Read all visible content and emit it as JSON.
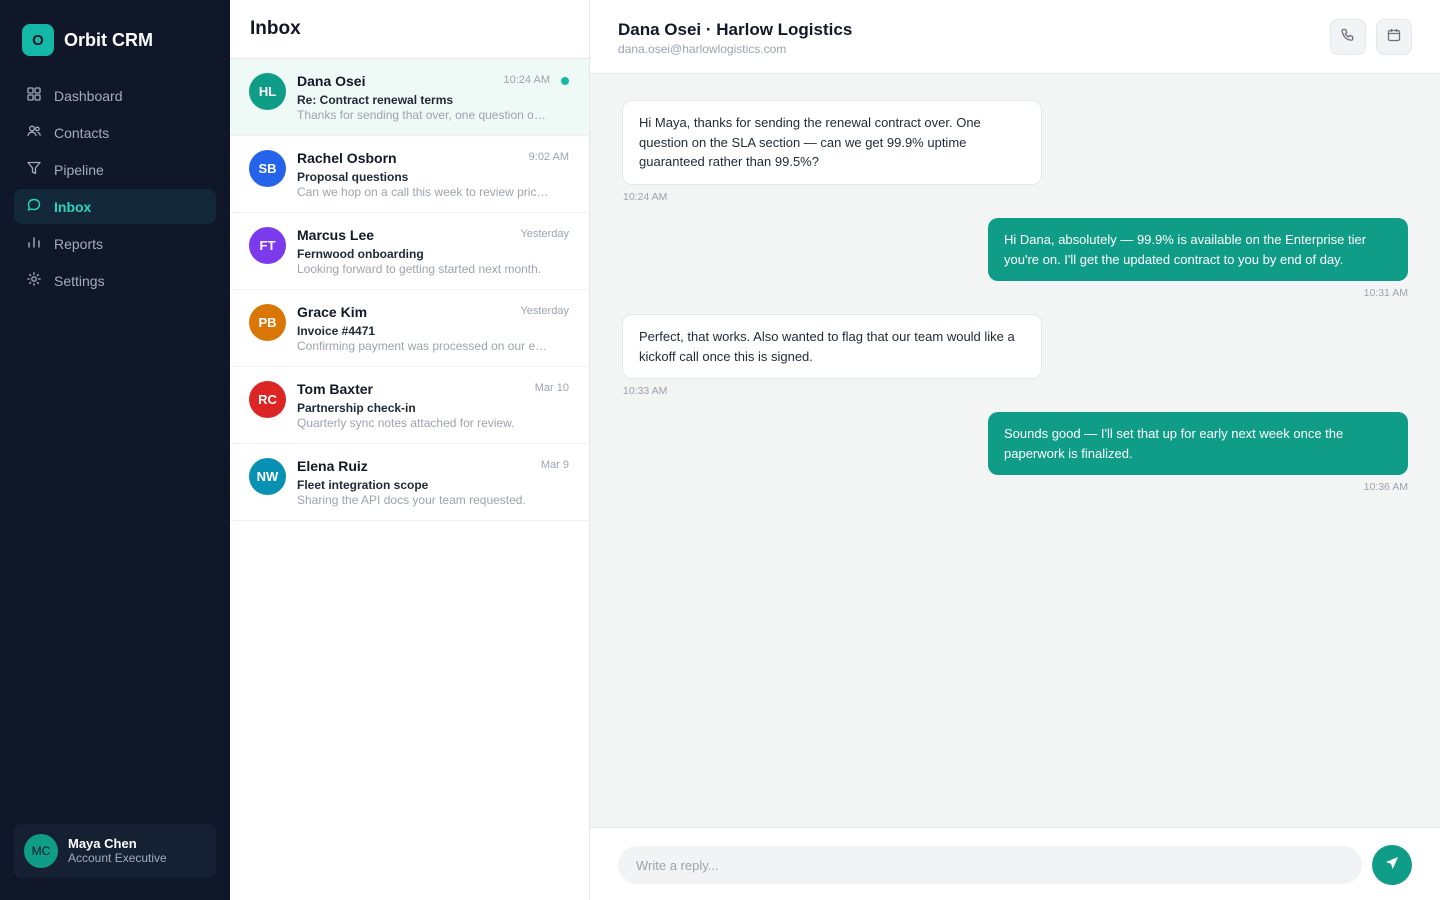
{
  "app": {
    "logo_letter": "O",
    "name": "Orbit CRM"
  },
  "nav": {
    "items": [
      {
        "label": "Dashboard",
        "icon": "grid-icon",
        "active": false
      },
      {
        "label": "Contacts",
        "icon": "users-icon",
        "active": false
      },
      {
        "label": "Pipeline",
        "icon": "funnel-icon",
        "active": false
      },
      {
        "label": "Inbox",
        "icon": "chat-bubble-icon",
        "active": true
      },
      {
        "label": "Reports",
        "icon": "bar-chart-icon",
        "active": false
      },
      {
        "label": "Settings",
        "icon": "gear-icon",
        "active": false
      }
    ]
  },
  "user": {
    "initials": "MC",
    "name": "Maya Chen",
    "role": "Account Executive"
  },
  "inbox": {
    "title": "Inbox",
    "conversations": [
      {
        "initials": "HL",
        "name": "Dana Osei",
        "subject": "Re: Contract renewal terms",
        "preview": "Thanks for sending that over, one question on the SLA section",
        "time": "10:24 AM",
        "color": "#0f9d88",
        "unread": true,
        "active": true
      },
      {
        "initials": "SB",
        "name": "Rachel Osborn",
        "subject": "Proposal questions",
        "preview": "Can we hop on a call this week to review pricing?",
        "time": "9:02 AM",
        "color": "#2563eb",
        "unread": false,
        "active": false
      },
      {
        "initials": "FT",
        "name": "Marcus Lee",
        "subject": "Fernwood onboarding",
        "preview": "Looking forward to getting started next month.",
        "time": "Yesterday",
        "color": "#7c3aed",
        "unread": false,
        "active": false
      },
      {
        "initials": "PB",
        "name": "Grace Kim",
        "subject": "Invoice #4471",
        "preview": "Confirming payment was processed on our end.",
        "time": "Yesterday",
        "color": "#d97706",
        "unread": false,
        "active": false
      },
      {
        "initials": "RC",
        "name": "Tom Baxter",
        "subject": "Partnership check-in",
        "preview": "Quarterly sync notes attached for review.",
        "time": "Mar 10",
        "color": "#dc2626",
        "unread": false,
        "active": false
      },
      {
        "initials": "NW",
        "name": "Elena Ruiz",
        "subject": "Fleet integration scope",
        "preview": "Sharing the API docs your team requested.",
        "time": "Mar 9",
        "color": "#0891b2",
        "unread": false,
        "active": false
      }
    ]
  },
  "chat": {
    "title": "Dana Osei · Harlow Logistics",
    "email": "dana.osei@harlowlogistics.com",
    "header_actions": [
      {
        "icon": "phone-icon"
      },
      {
        "icon": "calendar-icon"
      }
    ],
    "messages": [
      {
        "direction": "in",
        "text": "Hi Maya, thanks for sending the renewal contract over. One question on the SLA section — can we get 99.9% uptime guaranteed rather than 99.5%?",
        "time": "10:24 AM"
      },
      {
        "direction": "out",
        "text": "Hi Dana, absolutely — 99.9% is available on the Enterprise tier you're on. I'll get the updated contract to you by end of day.",
        "time": "10:31 AM"
      },
      {
        "direction": "in",
        "text": "Perfect, that works. Also wanted to flag that our team would like a kickoff call once this is signed.",
        "time": "10:33 AM"
      },
      {
        "direction": "out",
        "text": "Sounds good — I'll set that up for early next week once the paperwork is finalized.",
        "time": "10:36 AM"
      }
    ],
    "reply_placeholder": "Write a reply...",
    "send_icon": "send-icon"
  },
  "colors": {
    "sidebar_bg": "#0f1729",
    "accent": "#14b8a6",
    "bubble_out": "#0f9d88"
  }
}
